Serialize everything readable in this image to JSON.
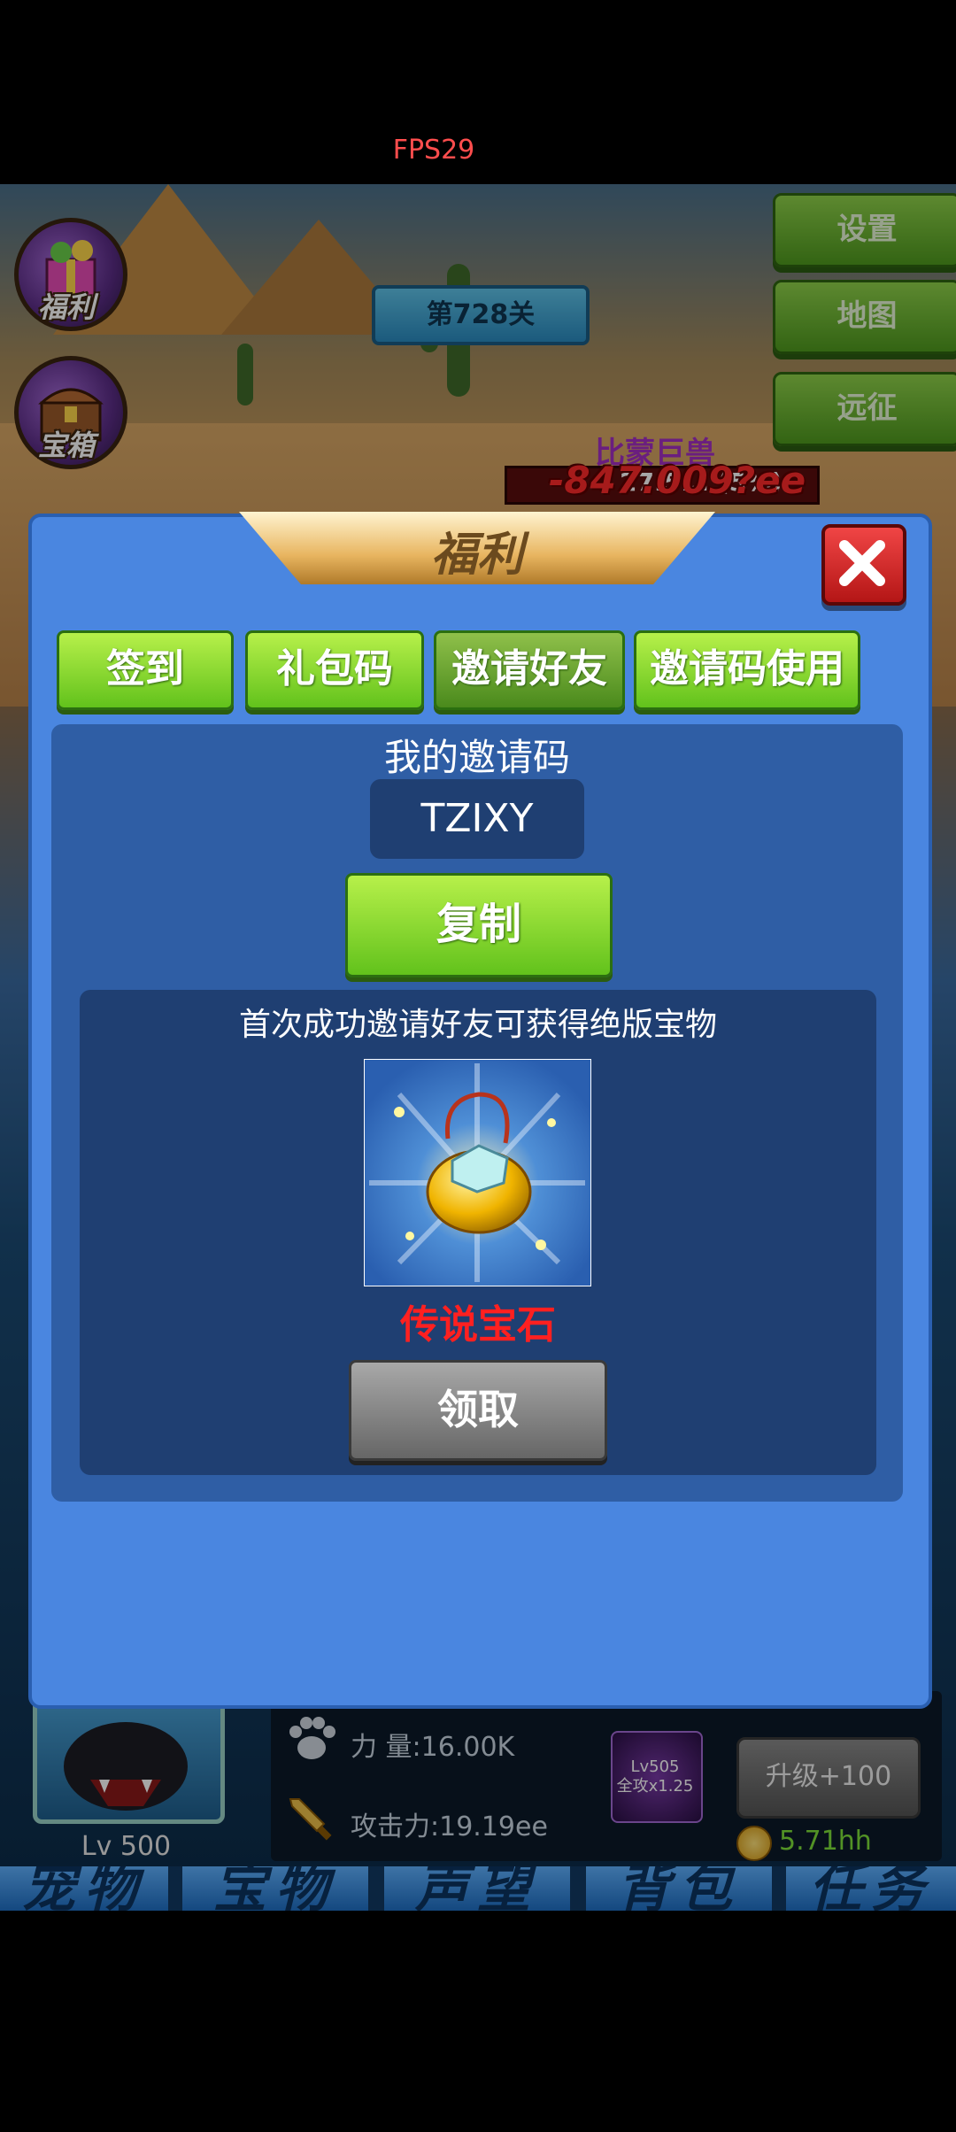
{
  "status": {
    "fps": "FPS29"
  },
  "game": {
    "stage": "第728关",
    "side_menu": [
      {
        "label": "福利",
        "icon": "gift-icon"
      },
      {
        "label": "宝箱",
        "icon": "treasure-chest-icon"
      }
    ],
    "right_menu": [
      {
        "label": "设置"
      },
      {
        "label": "地图"
      },
      {
        "label": "远征"
      }
    ],
    "boss": {
      "name": "比蒙巨兽",
      "hp_text": "27.5... (5%)",
      "damage_text": "-847.009?ee"
    },
    "pet": {
      "level": "Lv 500"
    },
    "stats": {
      "power_label": "力  量:16.00K",
      "attack_label": "攻击力:19.19ee"
    },
    "skill": {
      "level": "Lv505",
      "effect": "全攻x1.25"
    },
    "upgrade": {
      "label": "升级+100",
      "cost": "5.71hh"
    },
    "bottom_nav": [
      "宠物",
      "宝物",
      "声望",
      "背包",
      "任务"
    ]
  },
  "modal": {
    "title": "福利",
    "tabs": [
      {
        "label": "签到",
        "active": false
      },
      {
        "label": "礼包码",
        "active": false
      },
      {
        "label": "邀请好友",
        "active": true
      },
      {
        "label": "邀请码使用",
        "active": false
      }
    ],
    "invite": {
      "my_code_label": "我的邀请码",
      "code": "TZIXY",
      "copy_label": "复制",
      "reward_desc": "首次成功邀请好友可获得绝版宝物",
      "reward_name": "传说宝石",
      "claim_label": "领取"
    }
  },
  "colors": {
    "accent_green": "#62c21c",
    "modal_blue": "#4a86e0",
    "reward_red": "#ff2020",
    "claim_gray": "#888888"
  }
}
